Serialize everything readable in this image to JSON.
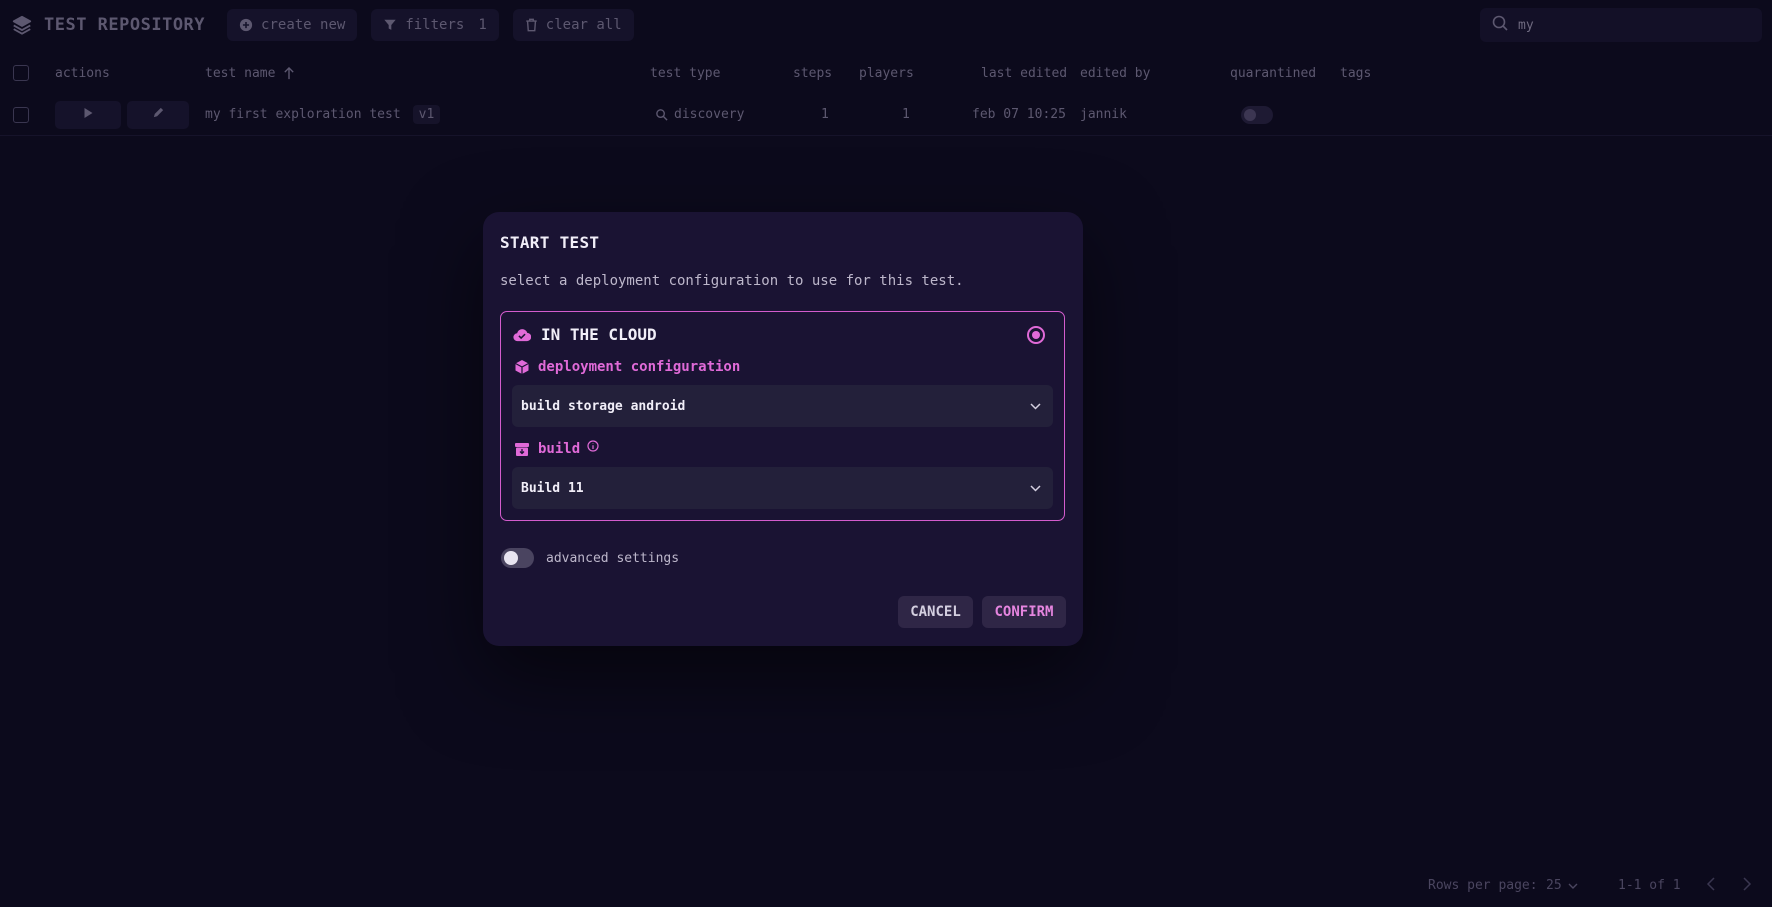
{
  "topbar": {
    "app_title": "TEST REPOSITORY",
    "create_label": "create new",
    "filters_label": "filters",
    "filters_count": "1",
    "clear_label": "clear all",
    "search_value": "my"
  },
  "table": {
    "columns": {
      "actions": "actions",
      "test_name": "test name",
      "test_type": "test type",
      "steps": "steps",
      "players": "players",
      "last_edited": "last edited",
      "edited_by": "edited by",
      "quarantined": "quarantined",
      "tags": "tags"
    },
    "rows": [
      {
        "name": "my first exploration test",
        "version": "v1",
        "type": "discovery",
        "steps": "1",
        "players": "1",
        "last_edited": "feb 07 10:25",
        "edited_by": "jannik"
      }
    ]
  },
  "footer": {
    "rows_per_page_label": "Rows per page:",
    "rows_per_page_value": "25",
    "range": "1-1 of 1"
  },
  "modal": {
    "title": "START TEST",
    "subtitle": "select a deployment configuration to use for this test.",
    "option_title": "IN THE CLOUD",
    "deployment_label": "deployment configuration",
    "deployment_value": "build storage android",
    "build_label": "build",
    "build_value": "Build 11",
    "advanced_label": "advanced settings",
    "cancel_label": "CANCEL",
    "confirm_label": "CONFIRM"
  },
  "colors": {
    "accent": "#e06ad8",
    "background": "#0c0a1c",
    "modal": "#1a1333"
  }
}
